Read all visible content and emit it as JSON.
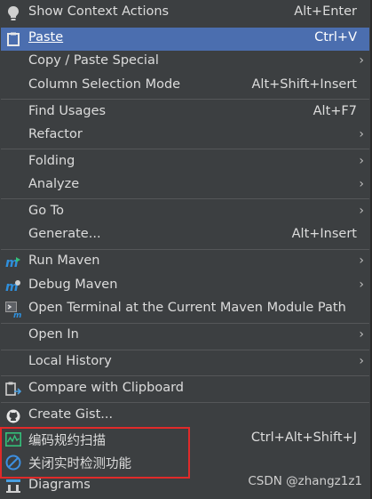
{
  "menu": {
    "items": [
      {
        "label": "Show Context Actions",
        "shortcut": "Alt+Enter"
      },
      {
        "label": "Paste",
        "shortcut": "Ctrl+V"
      },
      {
        "label": "Copy / Paste Special"
      },
      {
        "label": "Column Selection Mode",
        "shortcut": "Alt+Shift+Insert"
      },
      {
        "label": "Find Usages",
        "shortcut": "Alt+F7"
      },
      {
        "label": "Refactor"
      },
      {
        "label": "Folding"
      },
      {
        "label": "Analyze"
      },
      {
        "label": "Go To"
      },
      {
        "label": "Generate...",
        "shortcut": "Alt+Insert"
      },
      {
        "label": "Run Maven"
      },
      {
        "label": "Debug Maven"
      },
      {
        "label": "Open Terminal at the Current Maven Module Path"
      },
      {
        "label": "Open In"
      },
      {
        "label": "Local History"
      },
      {
        "label": "Compare with Clipboard"
      },
      {
        "label": "Create Gist..."
      },
      {
        "label": "编码规约扫描",
        "shortcut": "Ctrl+Alt+Shift+J"
      },
      {
        "label": "关闭实时检测功能"
      },
      {
        "label": "Diagrams"
      }
    ],
    "chevron": "›"
  },
  "watermark": "CSDN @zhangz1z1",
  "colors": {
    "background": "#3c3f41",
    "selected": "#4b6eaf",
    "highlight_border": "#e02a2a",
    "maven_blue": "#2f8fdc",
    "scan_green": "#34c07a"
  },
  "icons": [
    "bulb-icon",
    "clipboard-icon",
    "maven-run-icon",
    "maven-debug-icon",
    "terminal-maven-icon",
    "compare-clipboard-icon",
    "github-icon",
    "scan-chart-icon",
    "disable-icon",
    "diagram-icon"
  ]
}
